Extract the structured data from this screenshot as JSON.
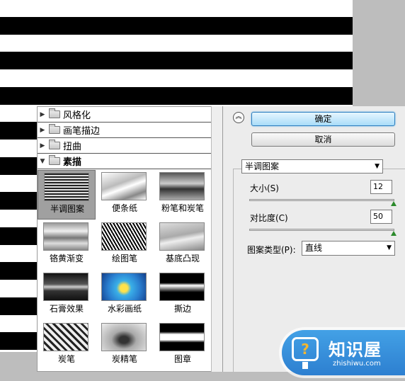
{
  "gallery": {
    "categories": [
      "风格化",
      "画笔描边",
      "扭曲",
      "素描"
    ],
    "thumbnails": [
      "半调图案",
      "便条纸",
      "粉笔和炭笔",
      "铬黄渐变",
      "绘图笔",
      "基底凸现",
      "石膏效果",
      "水彩画纸",
      "撕边",
      "炭笔",
      "炭精笔",
      "图章"
    ],
    "selected": "半调图案"
  },
  "panel": {
    "ok_label": "确定",
    "cancel_label": "取消",
    "filter_select": "半调图案",
    "size_label": "大小(S)",
    "size_value": "12",
    "size_level": 1.0,
    "contrast_label": "对比度(C)",
    "contrast_value": "50",
    "contrast_level": 1.0,
    "pattern_type_label": "图案类型(P):",
    "pattern_type_value": "直线"
  },
  "watermark": {
    "title": "知识屋",
    "url": "zhishiwu.com"
  },
  "colors": {
    "accent": "#43a1e6",
    "slider_knob": "#2b8a2b"
  },
  "icons": {
    "expand": "triangle-right-icon",
    "collapse": "triangle-down-icon",
    "folder": "folder-icon",
    "double_up": "double-chevron-up-icon"
  }
}
